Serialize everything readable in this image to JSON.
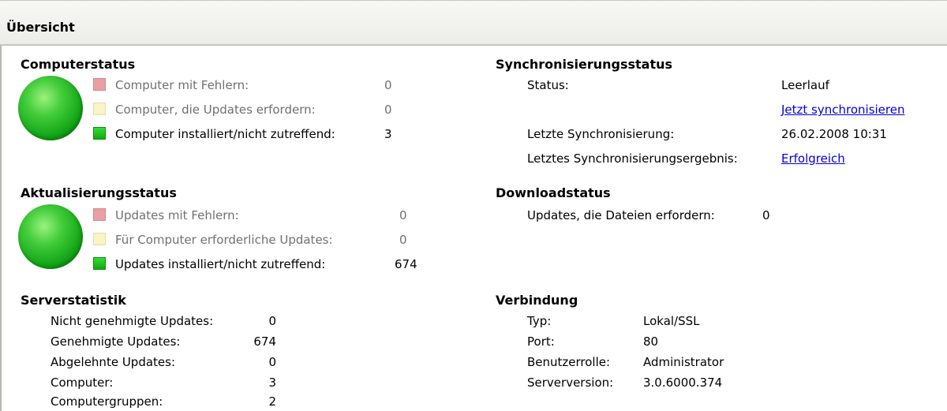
{
  "header": {
    "title": "Übersicht"
  },
  "computer_status": {
    "title": "Computerstatus",
    "rows": [
      {
        "label": "Computer mit Fehlern:",
        "value": "0",
        "color": "#e8a0a4"
      },
      {
        "label": "Computer, die Updates erfordern:",
        "value": "0",
        "color": "#fbf3c6"
      },
      {
        "label": "Computer installiert/nicht zutreffend:",
        "value": "3",
        "color": "#22c422"
      }
    ]
  },
  "update_status": {
    "title": "Aktualisierungsstatus",
    "rows": [
      {
        "label": "Updates mit Fehlern:",
        "value": "0",
        "color": "#e8a0a4"
      },
      {
        "label": "Für Computer erforderliche Updates:",
        "value": "0",
        "color": "#fbf3c6"
      },
      {
        "label": "Updates installiert/nicht zutreffend:",
        "value": "674",
        "color": "#22c422"
      }
    ]
  },
  "server_stats": {
    "title": "Serverstatistik",
    "rows": [
      {
        "label": "Nicht genehmigte Updates:",
        "value": "0"
      },
      {
        "label": "Genehmigte Updates:",
        "value": "674"
      },
      {
        "label": "Abgelehnte Updates:",
        "value": "0"
      },
      {
        "label": "Computer:",
        "value": "3"
      },
      {
        "label": "Computergruppen:",
        "value": "2"
      }
    ]
  },
  "sync_status": {
    "title": "Synchronisierungsstatus",
    "status_label": "Status:",
    "status_value": "Leerlauf",
    "sync_now_link": "Jetzt synchronisieren",
    "last_sync_label": "Letzte Synchronisierung:",
    "last_sync_value": "26.02.2008 10:31",
    "last_result_label": "Letztes Synchronisierungsergebnis:",
    "last_result_link": "Erfolgreich"
  },
  "download_status": {
    "title": "Downloadstatus",
    "label": "Updates, die Dateien erfordern:",
    "value": "0"
  },
  "connection": {
    "title": "Verbindung",
    "rows": [
      {
        "label": "Typ:",
        "value": "Lokal/SSL"
      },
      {
        "label": "Port:",
        "value": "80"
      },
      {
        "label": "Benutzerrolle:",
        "value": "Administrator"
      },
      {
        "label": "Serverversion:",
        "value": "3.0.6000.374"
      }
    ]
  },
  "colors": {
    "status_ok": "#22c422",
    "link": "#0000e0"
  }
}
